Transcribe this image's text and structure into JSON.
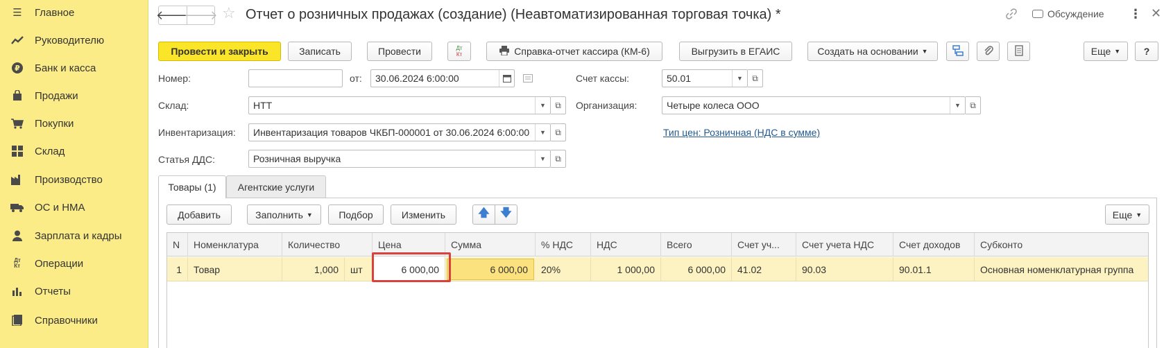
{
  "sidebar": {
    "items": [
      {
        "icon": "menu-icon",
        "label": "Главное"
      },
      {
        "icon": "trend-icon",
        "label": "Руководителю"
      },
      {
        "icon": "ruble-icon",
        "label": "Банк и касса"
      },
      {
        "icon": "bag-icon",
        "label": "Продажи"
      },
      {
        "icon": "cart-icon",
        "label": "Покупки"
      },
      {
        "icon": "grid-icon",
        "label": "Склад"
      },
      {
        "icon": "factory-icon",
        "label": "Производство"
      },
      {
        "icon": "truck-icon",
        "label": "ОС и НМА"
      },
      {
        "icon": "person-icon",
        "label": "Зарплата и кадры"
      },
      {
        "icon": "dt-kt-icon",
        "label": "Операции"
      },
      {
        "icon": "bar-chart-icon",
        "label": "Отчеты"
      },
      {
        "icon": "book-icon",
        "label": "Справочники"
      }
    ]
  },
  "titlebar": {
    "title": "Отчет о розничных продажах (создание) (Неавтоматизированная торговая точка) *",
    "discuss_label": "Обсуждение"
  },
  "toolbar": {
    "post_close": "Провести и закрыть",
    "save": "Записать",
    "post": "Провести",
    "dt_kt": "Дт\nКт",
    "cashier_report": "Справка-отчет кассира (КМ-6)",
    "egais": "Выгрузить в ЕГАИС",
    "create_based": "Создать на основании",
    "more": "Еще",
    "help": "?"
  },
  "form": {
    "number_label": "Номер:",
    "number_value": "",
    "from_label": "от:",
    "date_value": "30.06.2024  6:00:00",
    "cash_account_label": "Счет кассы:",
    "cash_account_value": "50.01",
    "warehouse_label": "Склад:",
    "warehouse_value": "НТТ",
    "org_label": "Организация:",
    "org_value": "Четыре колеса ООО",
    "inventory_label": "Инвентаризация:",
    "inventory_value": "Инвентаризация товаров ЧКБП-000001 от 30.06.2024 6:00:00",
    "price_type_link": "Тип цен: Розничная (НДС в сумме)",
    "dds_label": "Статья ДДС:",
    "dds_value": "Розничная выручка"
  },
  "tabs": [
    {
      "label": "Товары (1)"
    },
    {
      "label": "Агентские услуги"
    }
  ],
  "table_toolbar": {
    "add": "Добавить",
    "fill": "Заполнить",
    "pick": "Подбор",
    "change": "Изменить",
    "more": "Еще"
  },
  "table": {
    "columns": [
      "N",
      "Номенклатура",
      "Количество",
      "Цена",
      "Сумма",
      "% НДС",
      "НДС",
      "Всего",
      "Счет уч...",
      "Счет учета НДС",
      "Счет доходов",
      "Субконто"
    ],
    "rows": [
      {
        "n": "1",
        "item": "Товар",
        "qty": "1,000",
        "unit": "шт",
        "price": "6 000,00",
        "sum": "6 000,00",
        "vat_rate": "20%",
        "vat": "1 000,00",
        "total": "6 000,00",
        "account": "41.02",
        "vat_account": "90.03",
        "income_account": "90.01.1",
        "subconto": "Основная номенклатурная группа"
      }
    ]
  }
}
